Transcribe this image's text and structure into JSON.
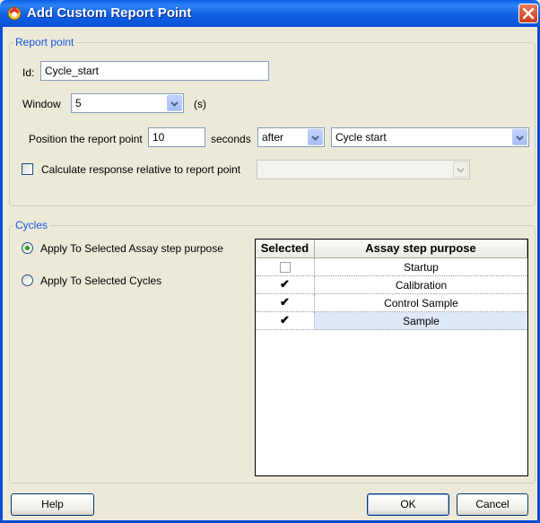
{
  "window": {
    "title": "Add Custom Report Point"
  },
  "report_point": {
    "legend": "Report point",
    "id_label": "Id:",
    "id_value": "Cycle_start",
    "window_label": "Window",
    "window_value": "5",
    "window_unit": "(s)",
    "position_label": "Position the report point",
    "position_value": "10",
    "seconds_label": "seconds",
    "direction_value": "after",
    "event_value": "Cycle start",
    "relative_label": "Calculate response relative to report point",
    "relative_checked": false
  },
  "cycles": {
    "legend": "Cycles",
    "option_assay": "Apply To Selected Assay step purpose",
    "option_cycles": "Apply To Selected Cycles",
    "selected_option": "assay",
    "table": {
      "headers": [
        "Selected",
        "Assay step purpose"
      ],
      "rows": [
        {
          "selected": false,
          "purpose": "Startup"
        },
        {
          "selected": true,
          "purpose": "Calibration"
        },
        {
          "selected": true,
          "purpose": "Control Sample"
        },
        {
          "selected": true,
          "purpose": "Sample"
        }
      ]
    }
  },
  "buttons": {
    "help": "Help",
    "ok": "OK",
    "cancel": "Cancel"
  },
  "icons": {
    "title": "app-icon",
    "close": "close-icon",
    "dropdown": "chevron-down-icon",
    "check": "check-icon",
    "radio": "radio-dot-icon"
  },
  "colors": {
    "title_bar": "#0a5fe8",
    "legend_text": "#1a54e0",
    "selected_row": "#dfe8f7",
    "radio_dot": "#21a121"
  }
}
